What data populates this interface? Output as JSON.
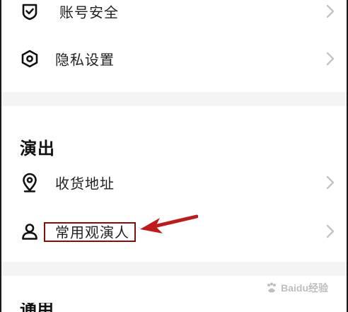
{
  "settings": {
    "items": [
      {
        "label": "账号安全",
        "icon": "shield-check-icon"
      },
      {
        "label": "隐私设置",
        "icon": "privacy-hexagon-icon"
      }
    ]
  },
  "performance": {
    "title": "演出",
    "items": [
      {
        "label": "收货地址",
        "icon": "location-pin-icon"
      },
      {
        "label": "常用观演人",
        "icon": "person-icon"
      }
    ]
  },
  "next_section": {
    "title": "通用"
  },
  "annotation": {
    "color": "#c11a1a",
    "box_color": "#7a1010"
  },
  "watermark": {
    "text": "Baidu经验"
  }
}
